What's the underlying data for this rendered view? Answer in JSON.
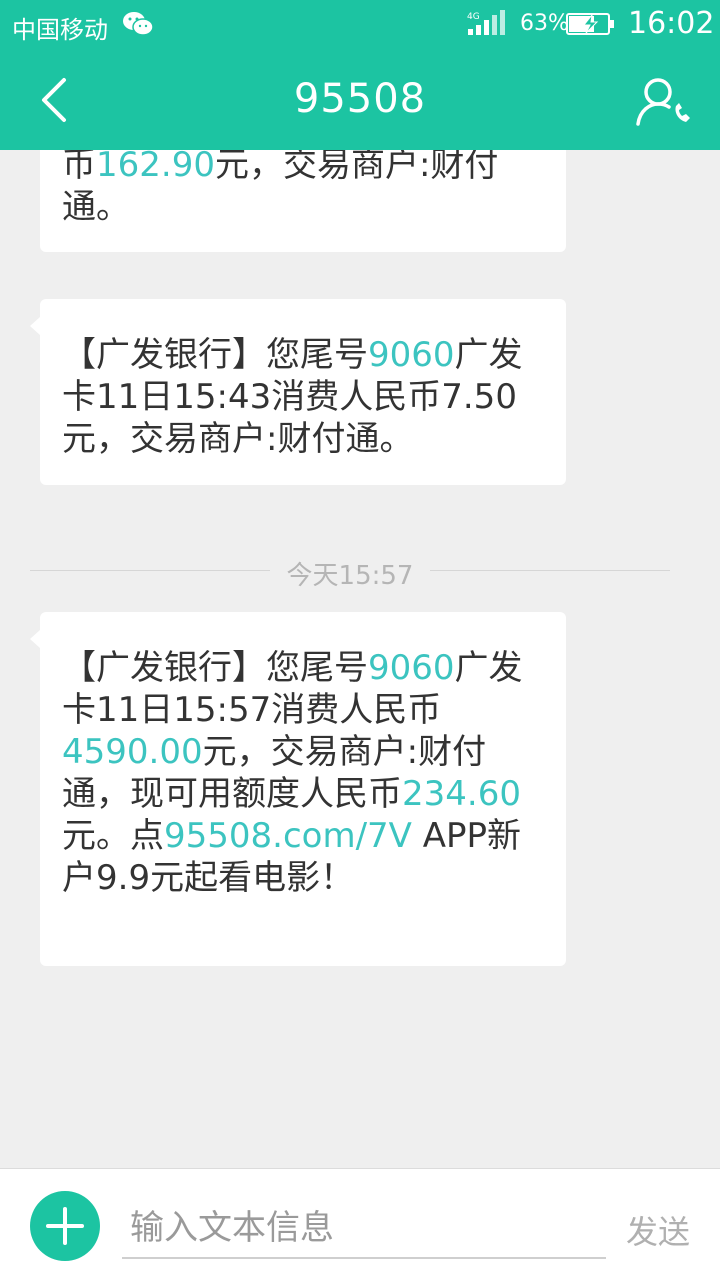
{
  "status_bar": {
    "carrier": "中国移动",
    "network": "4G",
    "battery": "63%",
    "time": "16:02"
  },
  "header": {
    "title": "95508"
  },
  "messages": [
    {
      "parts": [
        {
          "text": "币",
          "hl": false
        },
        {
          "text": "162.90",
          "hl": true
        },
        {
          "text": "元，交易商户:财付通。",
          "hl": false
        }
      ]
    },
    {
      "parts": [
        {
          "text": "【广发银行】您尾号",
          "hl": false
        },
        {
          "text": "9060",
          "hl": true
        },
        {
          "text": "广发卡11日15:43消费人民币7.50元，交易商户:财付通。",
          "hl": false
        }
      ]
    },
    {
      "parts": [
        {
          "text": "【广发银行】您尾号",
          "hl": false
        },
        {
          "text": "9060",
          "hl": true
        },
        {
          "text": "广发卡11日15:57消费人民币",
          "hl": false
        },
        {
          "text": "4590.00",
          "hl": true
        },
        {
          "text": "元，交易商户:财付通，现可用额度人民币",
          "hl": false
        },
        {
          "text": "234.60",
          "hl": true
        },
        {
          "text": "元。点",
          "hl": false
        },
        {
          "text": "95508.com/7V",
          "hl": true
        },
        {
          "text": " APP新户9.9元起看电影！",
          "hl": false
        }
      ]
    }
  ],
  "time_divider": "今天15:57",
  "composer": {
    "placeholder": "输入文本信息",
    "value": "",
    "send_label": "发送"
  },
  "colors": {
    "accent": "#1cc4a2",
    "highlight": "#3cc4c0",
    "background": "#efefef"
  }
}
